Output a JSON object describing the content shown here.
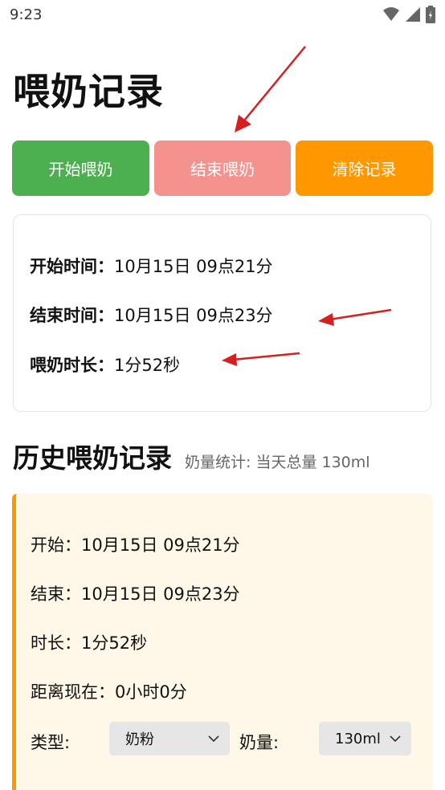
{
  "status_bar": {
    "time": "9:23",
    "icons": [
      "wifi-icon",
      "signal-icon",
      "battery-icon"
    ]
  },
  "page_title": "喂奶记录",
  "buttons": {
    "start": "开始喂奶",
    "end": "结束喂奶",
    "clear": "清除记录"
  },
  "colors": {
    "start_button": "#4caf50",
    "end_button": "#f4928e",
    "clear_button": "#ff9800",
    "record_accent": "#ff9800",
    "record_bg": "#fff8e8",
    "annotation_arrow": "#d62020"
  },
  "current": {
    "start_label": "开始时间：",
    "start_value": "10月15日 09点21分",
    "end_label": "结束时间：",
    "end_value": "10月15日 09点23分",
    "duration_label": "喂奶时长：",
    "duration_value": "1分52秒"
  },
  "history": {
    "title": "历史喂奶记录",
    "stats": "奶量统计: 当天总量 130ml",
    "records": [
      {
        "start_label": "开始：",
        "start_value": "10月15日 09点21分",
        "end_label": "结束：",
        "end_value": "10月15日 09点23分",
        "duration_label": "时长：",
        "duration_value": "1分52秒",
        "elapsed_label": "距离现在：",
        "elapsed_value": "0小时0分",
        "type_label": "类型:",
        "type_value": "奶粉",
        "amount_label": "奶量:",
        "amount_value": "130ml"
      }
    ]
  }
}
